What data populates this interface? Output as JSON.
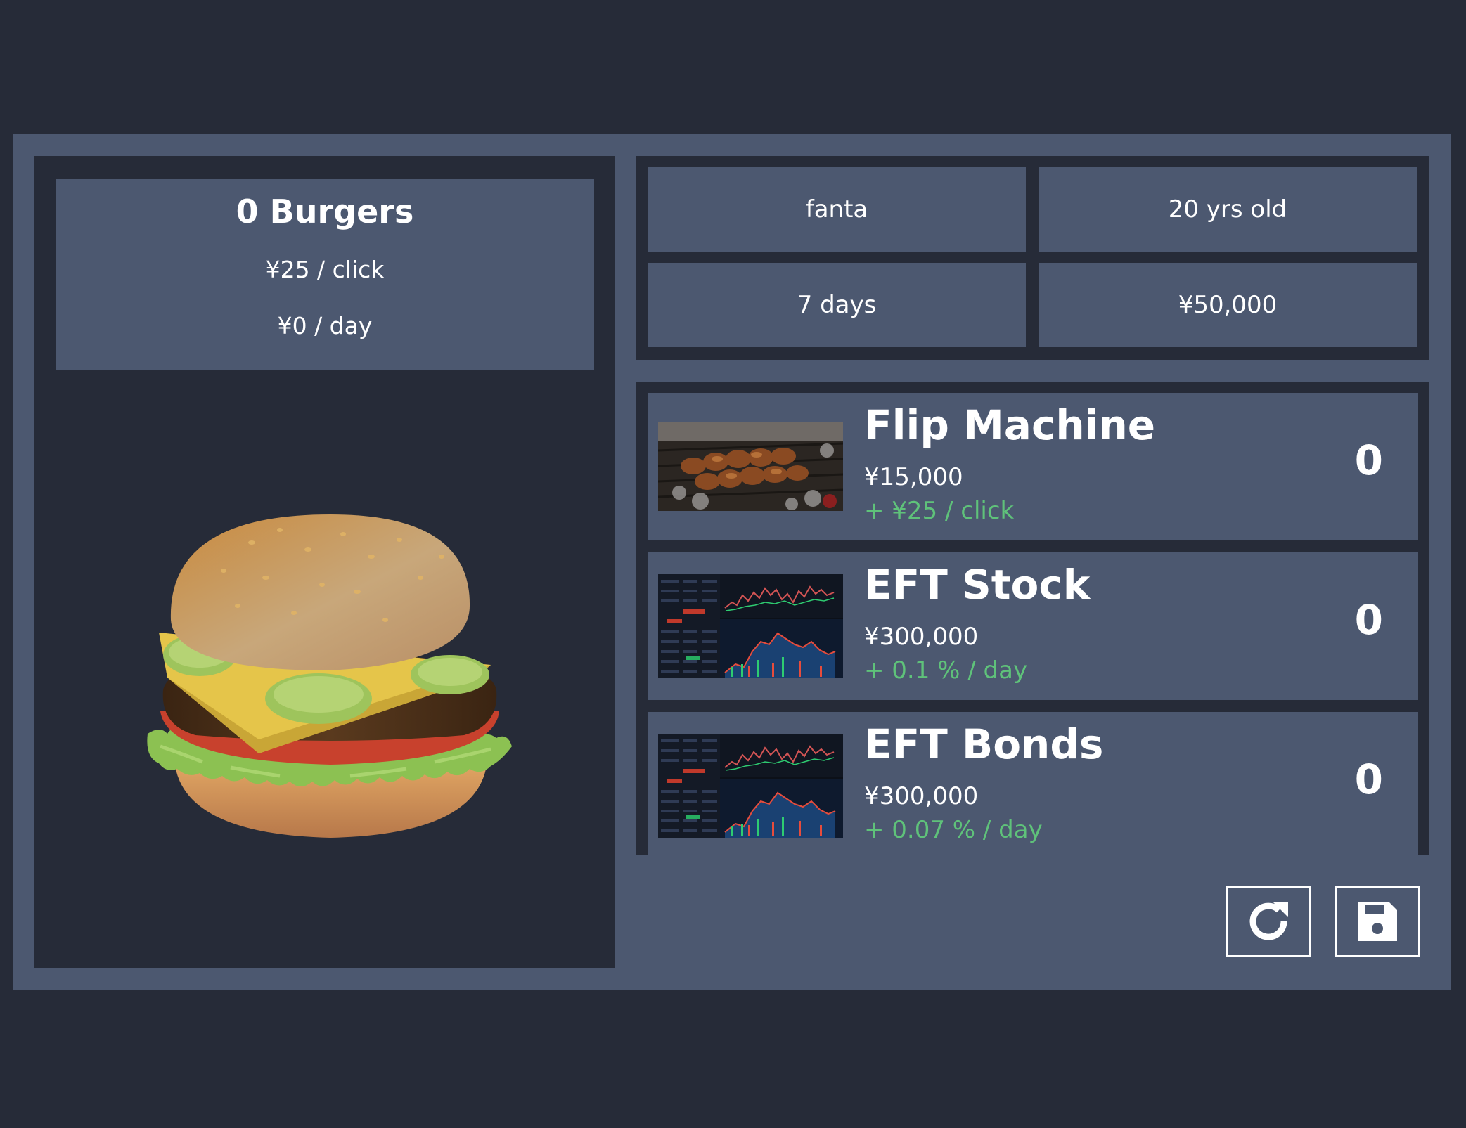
{
  "stats": {
    "burgers": "0 Burgers",
    "per_click": "¥25 / click",
    "per_day": "¥0 / day"
  },
  "info": {
    "name": "fanta",
    "age": "20 yrs old",
    "days": "7 days",
    "money": "¥50,000"
  },
  "shop": {
    "items": [
      {
        "name": "Flip Machine",
        "price": "¥15,000",
        "bonus": "+ ¥25 / click",
        "count": "0",
        "image": "grill-skewers-image"
      },
      {
        "name": "EFT Stock",
        "price": "¥300,000",
        "bonus": "+ 0.1 % / day",
        "count": "0",
        "image": "stock-chart-image"
      },
      {
        "name": "EFT Bonds",
        "price": "¥300,000",
        "bonus": "+ 0.07 % / day",
        "count": "0",
        "image": "stock-chart-image"
      }
    ]
  },
  "actions": {
    "reset_icon": "redo-icon",
    "save_icon": "floppy-disk-icon"
  },
  "colors": {
    "background": "#262b38",
    "panel": "#4c5870",
    "bonus_green": "#5fc27a"
  }
}
